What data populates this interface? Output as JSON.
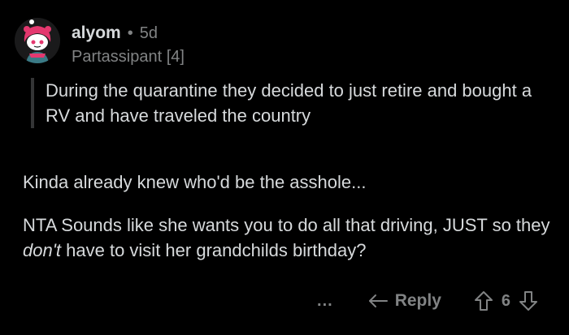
{
  "comment": {
    "author": "alyom",
    "separator": "•",
    "age": "5d",
    "flair": "Partassipant [4]",
    "quote": "During the quarantine they decided to just retire and bought a RV and have traveled the country",
    "paragraph1": "Kinda already knew who'd be the asshole...",
    "paragraph2": {
      "before": "NTA Sounds like she wants you to do all that driving, JUST so they ",
      "emphasis": "don't",
      "after": " have to visit her grandchilds birthday?"
    }
  },
  "actions": {
    "more_label": "...",
    "reply_label": "Reply",
    "score": "6",
    "icons": {
      "more": "more-options-icon",
      "reply": "reply-arrow-icon",
      "upvote": "upvote-arrow-icon",
      "downvote": "downvote-arrow-icon"
    }
  },
  "colors": {
    "background": "#000000",
    "text": "#d7dadc",
    "muted": "#818384",
    "quote_bar": "#343536",
    "avatar_accent": "#e4386f"
  }
}
